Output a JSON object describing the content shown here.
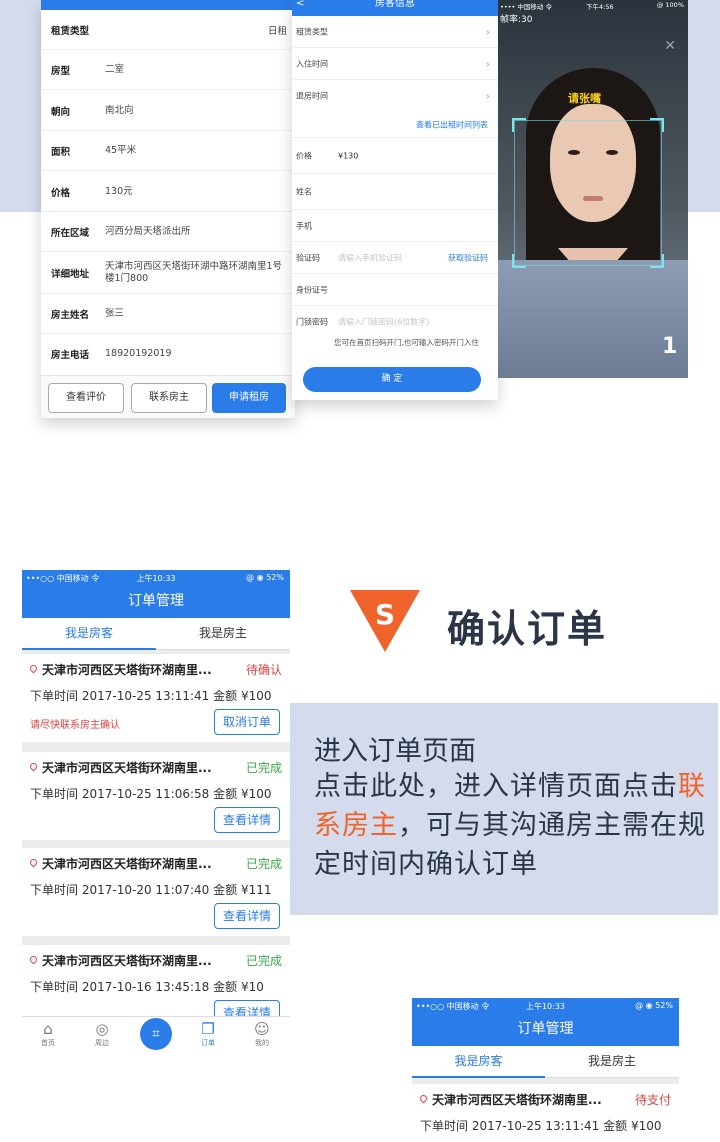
{
  "screen_detail": {
    "rows": [
      {
        "label": "租赁类型",
        "value": "日租"
      },
      {
        "label": "房型",
        "value": "二室"
      },
      {
        "label": "朝向",
        "value": "南北向"
      },
      {
        "label": "面积",
        "value": "45平米"
      },
      {
        "label": "价格",
        "value": "130元"
      },
      {
        "label": "所在区域",
        "value": "河西分局天塔派出所"
      },
      {
        "label": "详细地址",
        "value": "天津市河西区天塔街环湖中路环湖南里1号楼1门800"
      },
      {
        "label": "房主姓名",
        "value": "张三"
      },
      {
        "label": "房主电话",
        "value": "18920192019"
      }
    ],
    "buttons": {
      "review": "查看评价",
      "contact": "联系房主",
      "apply": "申请租房"
    }
  },
  "screen_guest": {
    "title": "房客信息",
    "back": "<",
    "rows": {
      "rent_type": "租赁类型",
      "checkin": "入住时间",
      "checkout": "退房时间",
      "view_list": "查看已出租时间列表",
      "price_label": "价格",
      "price_value": "¥130",
      "name": "姓名",
      "phone": "手机",
      "code_label": "验证码",
      "code_placeholder": "请输入手机验证码",
      "get_code": "获取验证码",
      "id": "身份证号",
      "pwd_label": "门锁密码",
      "pwd_placeholder": "请输入门锁密码(6位数字)"
    },
    "note": "您可在首页扫码开门,也可输入密码开门入住",
    "confirm": "确 定"
  },
  "screen_face": {
    "status_left": "•••• 中国移动 令",
    "status_time": "下午4:56",
    "status_right": "@ 100%",
    "fps": "帧率:30",
    "prompt": "请张嘴",
    "number": "1"
  },
  "order_phone": {
    "status_left": "•••○○ 中国移动 令",
    "status_time": "上午10:33",
    "status_right": "@ ◉ 52%",
    "title": "订单管理",
    "tabs": [
      "我是房客",
      "我是房主"
    ],
    "orders": [
      {
        "address": "天津市河西区天塔街环湖南里...",
        "status": "待确认",
        "status_color": "#e04242",
        "time_label": "下单时间",
        "time": "2017-10-25 13:11:41",
        "amount_label": "金额",
        "amount": "¥100",
        "hint": "请尽快联系房主确认",
        "button": "取消订单"
      },
      {
        "address": "天津市河西区天塔街环湖南里...",
        "status": "已完成",
        "status_color": "#3aa84a",
        "time_label": "下单时间",
        "time": "2017-10-25 11:06:58",
        "amount_label": "金额",
        "amount": "¥100",
        "hint": "",
        "button": "查看详情"
      },
      {
        "address": "天津市河西区天塔街环湖南里...",
        "status": "已完成",
        "status_color": "#3aa84a",
        "time_label": "下单时间",
        "time": "2017-10-20 11:07:40",
        "amount_label": "金额",
        "amount": "¥111",
        "hint": "",
        "button": "查看详情"
      },
      {
        "address": "天津市河西区天塔街环湖南里...",
        "status": "已完成",
        "status_color": "#3aa84a",
        "time_label": "下单时间",
        "time": "2017-10-16 13:45:18",
        "amount_label": "金额",
        "amount": "¥10",
        "hint": "",
        "button": "查看详情"
      }
    ],
    "nav": [
      {
        "label": "首页",
        "icon": "home-icon"
      },
      {
        "label": "周边",
        "icon": "nearby-icon"
      },
      {
        "label": "订单",
        "icon": "orders-icon"
      },
      {
        "label": "我的",
        "icon": "profile-icon"
      }
    ]
  },
  "step": {
    "number": "S",
    "title": "确认订单",
    "desc_title": "进入订单页面",
    "desc_pre": "点击此处，进入详情页面点击",
    "desc_highlight": "联系房主",
    "desc_post": "，可与其沟通房主需在规定时间内确认订单",
    "highlight_color": "#f0632a"
  },
  "order_phone2": {
    "status_left": "•••○○ 中国移动 令",
    "status_time": "上午10:33",
    "status_right": "@ ◉ 52%",
    "title": "订单管理",
    "tabs": [
      "我是房客",
      "我是房主"
    ],
    "order": {
      "address": "天津市河西区天塔街环湖南里...",
      "status": "待支付",
      "time_label": "下单时间",
      "time": "2017-10-25 13:11:41",
      "amount_label": "金额",
      "amount": "¥100"
    }
  }
}
